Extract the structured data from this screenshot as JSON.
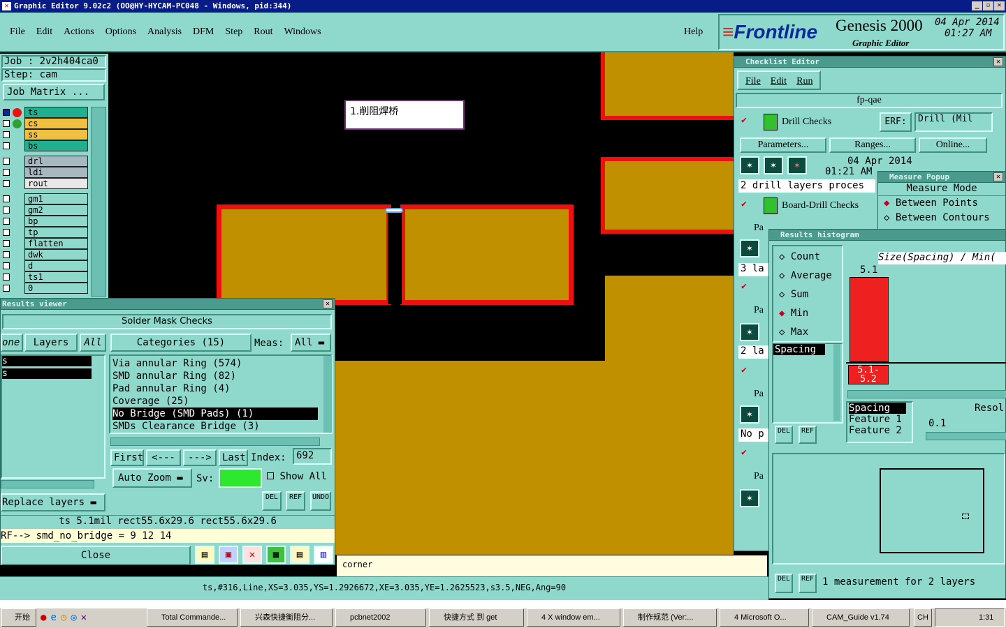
{
  "titlebar": {
    "title": "Graphic Editor 9.02c2 (OO@HY-HYCAM-PC048 - Windows, pid:344)"
  },
  "menu": [
    "File",
    "Edit",
    "Actions",
    "Options",
    "Analysis",
    "DFM",
    "Step",
    "Rout",
    "Windows"
  ],
  "help": "Help",
  "brand": {
    "logo": "Frontline",
    "product": "Genesis 2000",
    "subtitle": "Graphic Editor",
    "date": "04 Apr 2014",
    "time": "01:27 AM"
  },
  "job": {
    "job": "Job : 2v2h404ca0",
    "step": "Step: cam",
    "matrix": "Job Matrix ..."
  },
  "layers": [
    {
      "name": "ts",
      "color": "#20b090"
    },
    {
      "name": "cs",
      "color": "#f0c040"
    },
    {
      "name": "ss",
      "color": "#f0c040"
    },
    {
      "name": "bs",
      "color": "#20b090"
    },
    {
      "name": "drl",
      "color": "#a8b8c0"
    },
    {
      "name": "ldi",
      "color": "#a8b8c0"
    },
    {
      "name": "rout",
      "color": "#e8e8e8"
    },
    {
      "name": "gm1",
      "color": "#8fd8cc"
    },
    {
      "name": "gm2",
      "color": "#8fd8cc"
    },
    {
      "name": "bp",
      "color": "#8fd8cc"
    },
    {
      "name": "tp",
      "color": "#8fd8cc"
    },
    {
      "name": "flatten",
      "color": "#8fd8cc"
    },
    {
      "name": "dwk",
      "color": "#8fd8cc"
    },
    {
      "name": "d",
      "color": "#8fd8cc"
    },
    {
      "name": "ts1",
      "color": "#8fd8cc"
    },
    {
      "name": "0",
      "color": "#8fd8cc"
    }
  ],
  "canvas": {
    "annotation": "1.削阻焊桥"
  },
  "results": {
    "title": "Results viewer",
    "header": "Solder Mask Checks",
    "tab_one": "one",
    "tab_layers": "Layers",
    "tab_all": "All",
    "categories": "Categories (15)",
    "meas_label": "Meas:",
    "meas_value": "All",
    "left_items": [
      "s",
      "s"
    ],
    "items": [
      "Via annular Ring (574)",
      "SMD annular Ring (82)",
      "Pad annular Ring (4)",
      "Coverage (25)",
      "No Bridge (SMD Pads) (1)",
      "SMDs Clearance Bridge (3)"
    ],
    "nav": [
      "First",
      "<---",
      "--->",
      "Last"
    ],
    "index_label": "Index:",
    "index_value": "692",
    "zoom": "Auto Zoom",
    "sv": "Sv:",
    "show_all": "Show All",
    "replace": "Replace layers",
    "del": "DEL",
    "ref": "REF",
    "undo": "UNDO",
    "status1": "ts 5.1mil  rect55.6x29.6  rect55.6x29.6",
    "status2": "RF--> smd_no_bridge = 9 12 14",
    "close": "Close"
  },
  "checklist": {
    "title": "Checklist Editor",
    "menu": [
      "File",
      "Edit",
      "Run"
    ],
    "name": "fp-qae",
    "drill_checks": "Drill Checks",
    "erf": "ERF:",
    "drill_mil": "Drill (Mil",
    "params": "Parameters...",
    "ranges": "Ranges...",
    "online": "Online...",
    "date": "04 Apr 2014",
    "time": "01:21 AM",
    "proc": "2 drill layers proces",
    "board_drill": "Board-Drill Checks",
    "pa": "Pa",
    "la3": "3 la",
    "la2": "2 la",
    "nop": "No p"
  },
  "measure": {
    "title": "Measure Popup",
    "mode": "Measure Mode",
    "between_points": "Between Points",
    "between_contours": "Between Contours"
  },
  "histogram": {
    "title": "Results histogram",
    "options": [
      "Count",
      "Average",
      "Sum",
      "Min",
      "Max"
    ],
    "selected": "Min",
    "list_item": "Spacing",
    "size_header": "Size(Spacing) / Min(",
    "bar_value": "5.1",
    "bar_range": "5.1-\n5.2",
    "list2": [
      "Spacing",
      "Feature 1",
      "Feature 2"
    ],
    "resol": "Resol",
    "resol_value": "0.1",
    "summary": "1 measurement for 2 layers"
  },
  "statusbar": {
    "hint": "corner",
    "coords": "ts,#316,Line,XS=3.035,YS=1.2926672,XE=3.035,YE=1.2625523,s3.5,NEG,Ang=90"
  },
  "taskbar": {
    "start": "开始",
    "items": [
      "Total Commande...",
      "兴森快捷衡阻分...",
      "pcbnet2002",
      "快捷方式 到 get",
      "4 X window em...",
      "制作规范 (Ver:...",
      "4 Microsoft O...",
      "CAM_Guide v1.74"
    ],
    "lang": "CH",
    "clock": "1:31"
  }
}
